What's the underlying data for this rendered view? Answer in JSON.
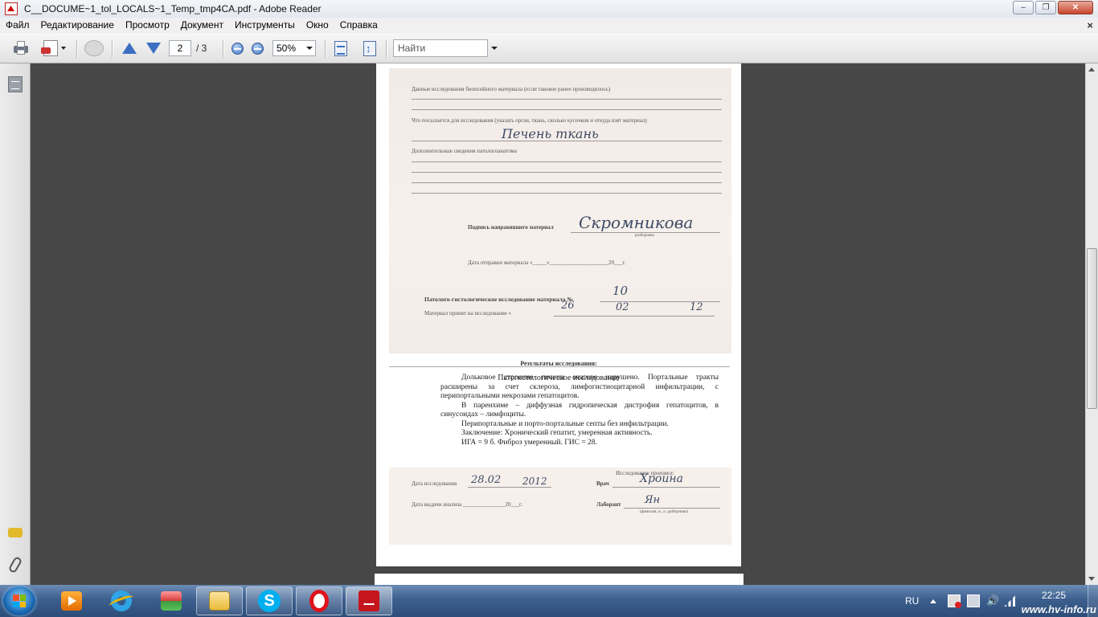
{
  "window": {
    "title": "C__DOCUME~1_tol_LOCALS~1_Temp_tmp4CA.pdf - Adobe Reader",
    "minimize": "–",
    "restore": "❐",
    "close": "✕"
  },
  "menu": {
    "items": [
      "Файл",
      "Редактирование",
      "Просмотр",
      "Документ",
      "Инструменты",
      "Окно",
      "Справка"
    ],
    "close_doc": "×"
  },
  "toolbar": {
    "page_current": "2",
    "page_total": "/ 3",
    "zoom": "50%",
    "search_placeholder": "Найти"
  },
  "document": {
    "form": {
      "l1": "Данные исследования биопсийного материала (если таковое ранее производилось)",
      "l2": "Что посылается для исследования (указать орган, ткань, сколько кусочков и откуда взят материал)",
      "h2": "Печень ткань",
      "l3": "Дополнительные сведения патологоанатома",
      "l4": "Подпись направившего материал",
      "h4": "Скромникова",
      "l4s": "разборчиво",
      "l5": "Дата отправки материала «_____»_____________________20___г.",
      "l6": "Патолого-гистологическое исследование материала №",
      "h6": "10",
      "l7": "Материал принят на исследование «",
      "h7a": "26",
      "h7b": "02",
      "h7c": "12"
    },
    "results_title": "Результаты исследования:",
    "section_title": "Патогистологическое исследование",
    "paragraphs": [
      "Дольковое строение печени очагово нарушено. Портальные тракты расширены за счет склероза, лимфогистиоцитарной инфильтрации, с перипортальными некрозами гепатоцитов.",
      "В паренхиме – диффузная гидропическая дистрофия гепатоцитов, в синусоидах – лимфоциты.",
      "Перипортальные и порто-портальные септы без инфильтрации.",
      "Заключение: Хронический гепатит, умеренная активность.",
      "ИГА = 9 б. Фиброз умеренный. ГИС = 28."
    ],
    "footer": {
      "performed": "Исследование произвел:",
      "date_label": "Дата исследования",
      "date_hand": "28.02",
      "year_hand": "2012",
      "doctor": "Врач",
      "doctor_hand": "Хроина",
      "issue_label": "Дата выдачи анализа _______________20___г.",
      "lab": "Лаборант",
      "lab_hand": "Ян",
      "lab_sub": "(фамилия, и., о. разборчиво)"
    }
  },
  "taskbar": {
    "lang": "RU",
    "time": "22:25",
    "watermark": "www.hv-info.ru"
  },
  "colors": {
    "title_bg": "#e3e8ef",
    "menubar_bg": "#f0f0f0",
    "doc_bg": "#474747",
    "taskbar": "#3c5f8f",
    "accent": "#3c6fc1"
  }
}
